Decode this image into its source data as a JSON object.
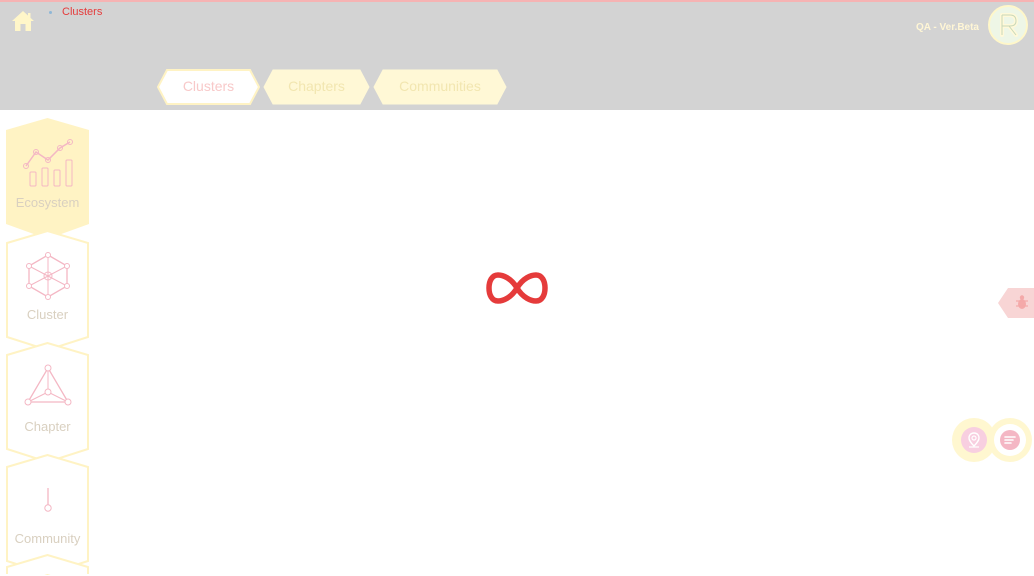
{
  "header": {
    "home_icon": "home-icon",
    "breadcrumb": "Clusters",
    "environment": "QA - Ver.Beta",
    "logo_letter": "R"
  },
  "tabs": [
    {
      "label": "Clusters",
      "active": true
    },
    {
      "label": "Chapters",
      "active": false
    },
    {
      "label": "Communities",
      "active": false
    }
  ],
  "sidenav": {
    "items": [
      {
        "label": "Ecosystem",
        "icon": "chart-icon",
        "active": true
      },
      {
        "label": "Cluster",
        "icon": "network-icon",
        "active": false
      },
      {
        "label": "Chapter",
        "icon": "triangle-nodes-icon",
        "active": false
      },
      {
        "label": "Community",
        "icon": "node-icon",
        "active": false
      }
    ]
  },
  "loader": {
    "icon": "infinity-loader-icon"
  },
  "floating": {
    "bug_icon": "bug-icon",
    "map_icon": "map-pin-icon",
    "list_icon": "list-icon"
  },
  "colors": {
    "header_bg": "#d3d3d3",
    "accent_red": "#e53b3b",
    "cream": "#fff7d0",
    "pink": "#f4b7c4"
  }
}
